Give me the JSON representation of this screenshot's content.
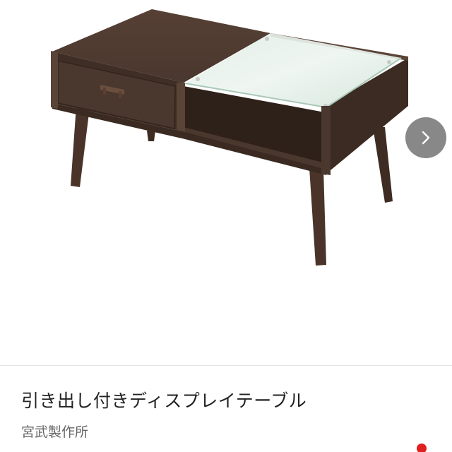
{
  "product": {
    "title": "引き出し付きディスプレイテーブル",
    "brand": "宮武製作所"
  },
  "carousel": {
    "next_icon": "chevron-right-icon"
  },
  "colors": {
    "wood": "#4a372d",
    "wood_dark": "#3a2a21",
    "glass": "#cfe3d8",
    "nav_button": "#6e6e6e",
    "accent": "#e02020"
  }
}
